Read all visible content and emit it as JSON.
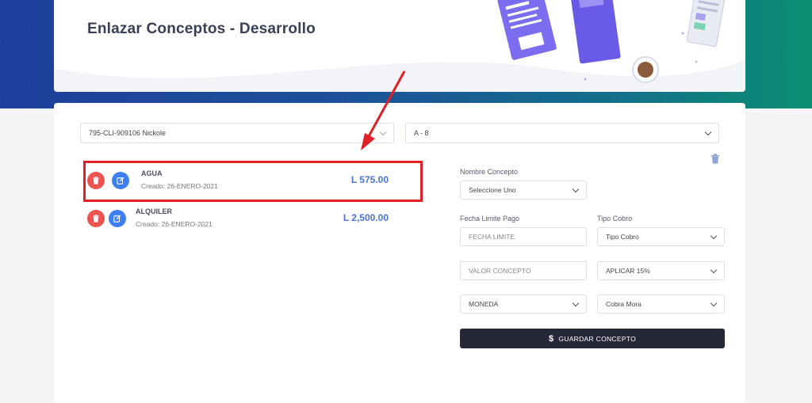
{
  "header": {
    "title": "Enlazar Conceptos - Desarrollo"
  },
  "filters": {
    "client_select": "795-CLI-909106 Nickole",
    "unit_select": "A - 8"
  },
  "concepts": [
    {
      "name": "AGUA",
      "created": "Creado: 26-ENERO-2021",
      "amount": "L 575.00"
    },
    {
      "name": "ALQUILER",
      "created": "Creado: 26-ENERO-2021",
      "amount": "L 2,500.00"
    }
  ],
  "form": {
    "nombre_concepto_label": "Nombre Concepto",
    "nombre_concepto_value": "Seleccione Uno",
    "fecha_limite_label": "Fecha Limite Pago",
    "fecha_limite_placeholder": "FECHA LIMITE",
    "tipo_cobro_label": "Tipo Cobro",
    "tipo_cobro_value": "Tipo Cobro",
    "valor_concepto_placeholder": "VALOR CONCEPTO",
    "aplicar_value": "APLICAR 15%",
    "moneda_value": "MONEDA",
    "cobra_mora_value": "Cobra Mora",
    "save_label": "GUARDAR CONCEPTO"
  },
  "colors": {
    "accent_blue": "#4a72d6",
    "danger_red": "#ef5350",
    "edit_blue": "#3d7ff2",
    "highlight_red": "#e01f26",
    "button_dark": "#262838"
  }
}
